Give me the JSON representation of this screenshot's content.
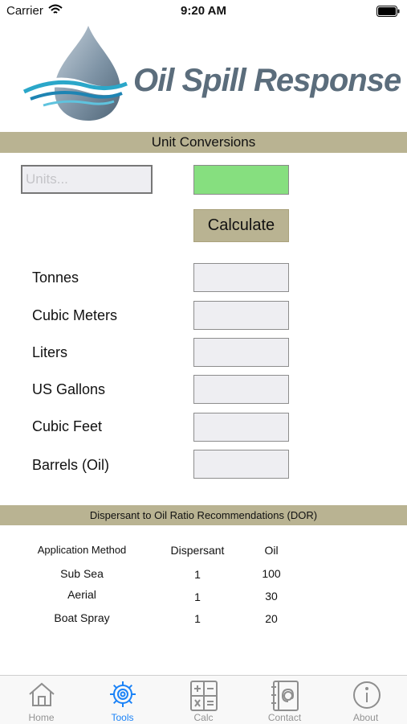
{
  "status": {
    "carrier": "Carrier",
    "time": "9:20 AM"
  },
  "logo": {
    "text": "Oil Spill Response"
  },
  "unit_conversions": {
    "title": "Unit Conversions",
    "units_placeholder": "Units...",
    "result_color": "#86df7f",
    "calculate_label": "Calculate",
    "rows": [
      {
        "label": "Tonnes"
      },
      {
        "label": "Cubic Meters"
      },
      {
        "label": "Liters"
      },
      {
        "label": "US Gallons"
      },
      {
        "label": "Cubic Feet"
      },
      {
        "label": "Barrels (Oil)"
      }
    ]
  },
  "dor": {
    "title": "Dispersant to Oil Ratio Recommendations (DOR)",
    "headers": [
      "Application Method",
      "Dispersant",
      "Oil"
    ],
    "rows": [
      [
        "Sub Sea",
        "1",
        "100"
      ],
      [
        "Aerial",
        "1",
        "30"
      ],
      [
        "Boat Spray",
        "1",
        "20"
      ]
    ]
  },
  "tabs": [
    {
      "label": "Home",
      "icon": "home-icon"
    },
    {
      "label": "Tools",
      "icon": "gear-icon",
      "active": true
    },
    {
      "label": "Calc",
      "icon": "calculator-icon"
    },
    {
      "label": "Contact",
      "icon": "contact-book-icon"
    },
    {
      "label": "About",
      "icon": "info-icon"
    }
  ],
  "colors": {
    "section_bar": "#b9b392",
    "tab_active": "#1a82f7",
    "tab_inactive": "#939393"
  }
}
